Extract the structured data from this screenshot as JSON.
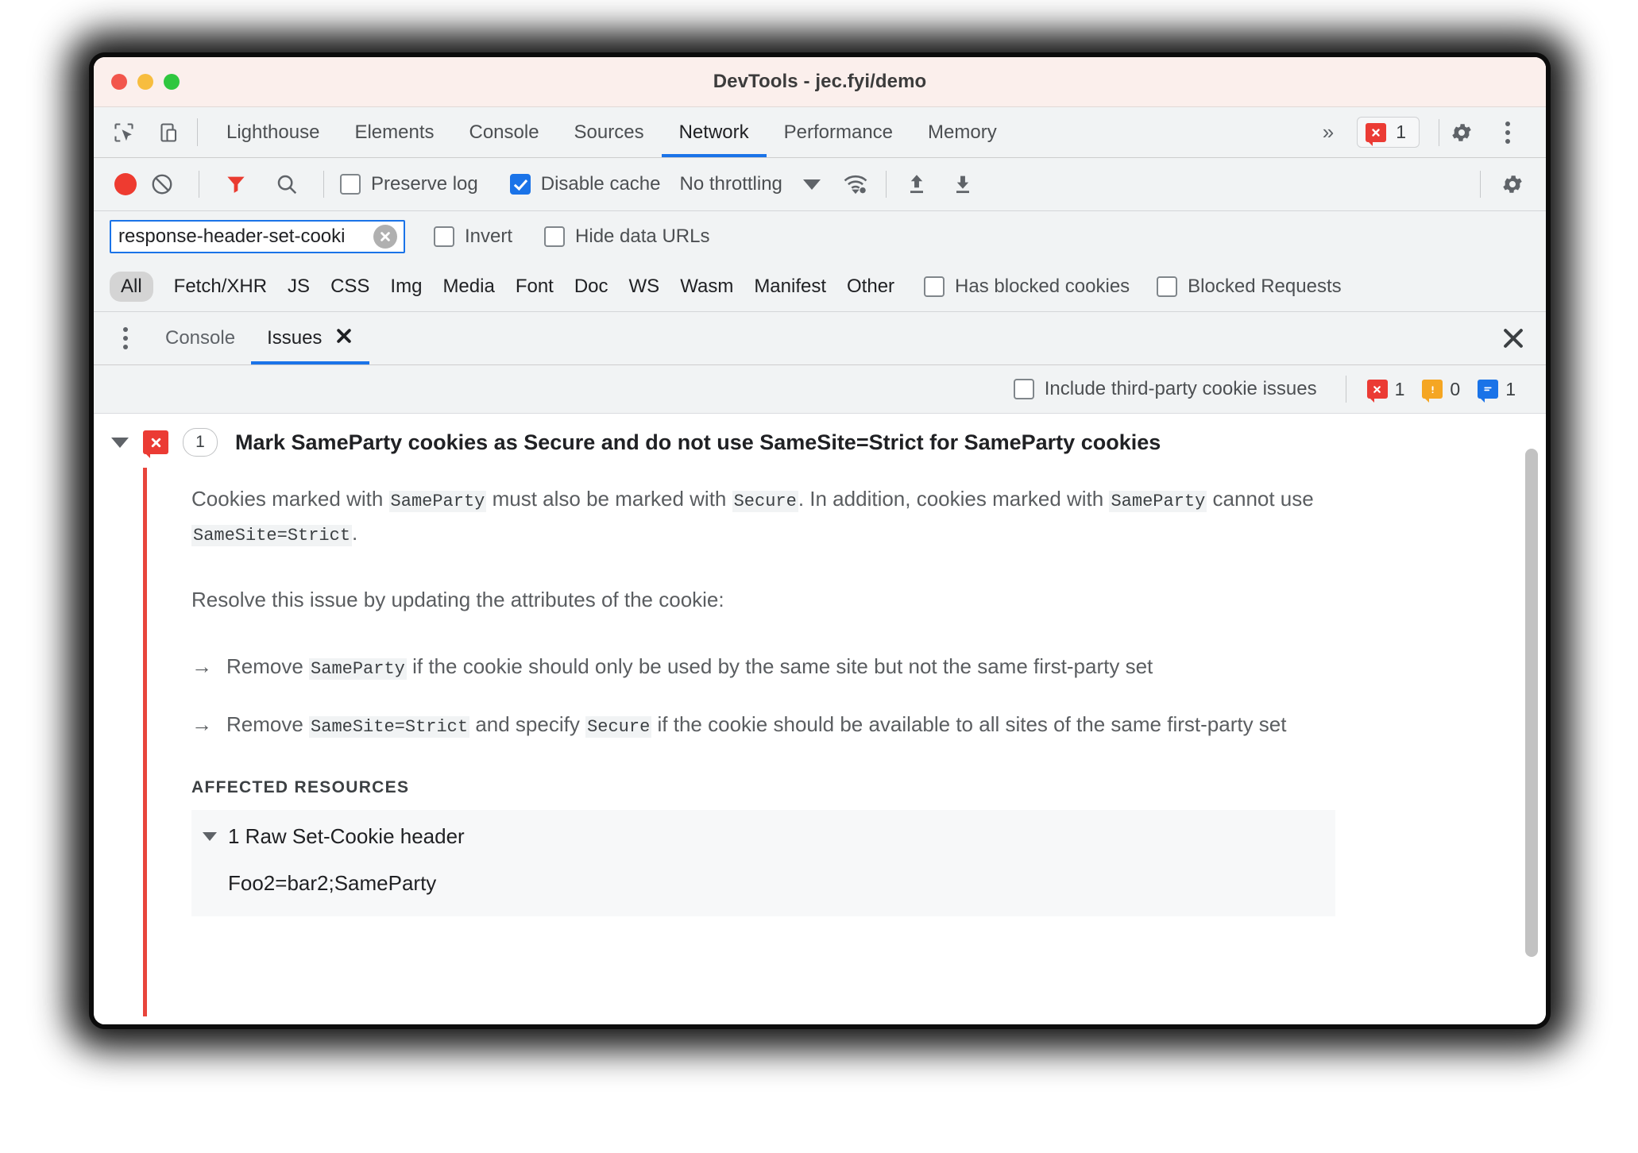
{
  "window": {
    "title": "DevTools - jec.fyi/demo",
    "traffic_lights": [
      "close",
      "minimize",
      "maximize"
    ]
  },
  "main_tabs": {
    "items": [
      {
        "label": "Lighthouse",
        "active": false
      },
      {
        "label": "Elements",
        "active": false
      },
      {
        "label": "Console",
        "active": false
      },
      {
        "label": "Sources",
        "active": false
      },
      {
        "label": "Network",
        "active": true
      },
      {
        "label": "Performance",
        "active": false
      },
      {
        "label": "Memory",
        "active": false
      }
    ],
    "overflow_label": "»",
    "error_badge_count": "1",
    "icons": [
      "inspect-icon",
      "device-toolbar-icon",
      "settings-gear-icon",
      "more-vertical-icon"
    ]
  },
  "network_toolbar": {
    "record_label": "record-button",
    "clear_label": "clear-button",
    "filter_label": "filter-button",
    "search_label": "search-button",
    "preserve_log": {
      "label": "Preserve log",
      "checked": false
    },
    "disable_cache": {
      "label": "Disable cache",
      "checked": true
    },
    "throttling": "No throttling",
    "icons": [
      "wifi-settings-icon",
      "upload-icon",
      "download-icon",
      "settings-gear-icon"
    ]
  },
  "filter_row": {
    "input_value": "response-header-set-cooki",
    "input_placeholder": "Filter",
    "invert": {
      "label": "Invert",
      "checked": false
    },
    "hide_data_urls": {
      "label": "Hide data URLs",
      "checked": false
    }
  },
  "type_filters": {
    "selected": "All",
    "items": [
      "All",
      "Fetch/XHR",
      "JS",
      "CSS",
      "Img",
      "Media",
      "Font",
      "Doc",
      "WS",
      "Wasm",
      "Manifest",
      "Other"
    ],
    "has_blocked_cookies": {
      "label": "Has blocked cookies",
      "checked": false
    },
    "blocked_requests": {
      "label": "Blocked Requests",
      "checked": false
    }
  },
  "drawer": {
    "tabs": [
      {
        "label": "Console",
        "active": false,
        "closable": false
      },
      {
        "label": "Issues",
        "active": true,
        "closable": true
      }
    ],
    "close_drawer_label": "close-drawer"
  },
  "issues_toolbar": {
    "include_third_party": {
      "label": "Include third-party cookie issues",
      "checked": false
    },
    "counters": [
      {
        "kind": "error",
        "count": "1",
        "color": "#eb3b34"
      },
      {
        "kind": "warning",
        "count": "0",
        "color": "#f5a623"
      },
      {
        "kind": "info",
        "count": "1",
        "color": "#1a73e8"
      }
    ]
  },
  "issue": {
    "expanded": true,
    "severity": "error",
    "count_badge": "1",
    "title": "Mark SameParty cookies as Secure and do not use SameSite=Strict for SameParty cookies",
    "paragraph1": {
      "part1": "Cookies marked with ",
      "code1": "SameParty",
      "part2": " must also be marked with ",
      "code2": "Secure",
      "part3": ". In addition, cookies marked with ",
      "code3": "SameParty",
      "part4": " cannot use ",
      "code4": "SameSite=Strict",
      "part5": "."
    },
    "paragraph2": "Resolve this issue by updating the attributes of the cookie:",
    "bullets": [
      {
        "marker": "→",
        "part1": "Remove ",
        "code1": "SameParty",
        "part2": " if the cookie should only be used by the same site but not the same first-party set"
      },
      {
        "marker": "→",
        "part1": "Remove ",
        "code1": "SameSite=Strict",
        "part2": " and specify ",
        "code2": "Secure",
        "part3": " if the cookie should be available to all sites of the same first-party set"
      }
    ],
    "affected_resources_label": "AFFECTED RESOURCES",
    "affected_header": "1 Raw Set-Cookie header",
    "affected_value": "Foo2=bar2;SameParty"
  },
  "colors": {
    "accent_blue": "#1a73e8",
    "error_red": "#eb3b34",
    "warning_orange": "#f5a623",
    "issue_rail": "#e8453c",
    "titlebar_bg": "#fbefec",
    "toolbar_bg": "#f1f3f4"
  }
}
